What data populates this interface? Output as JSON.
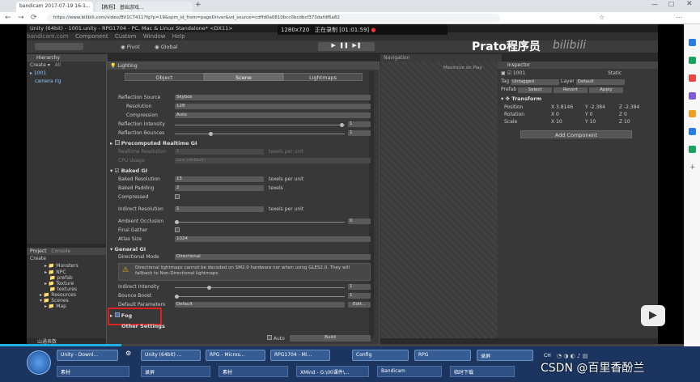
{
  "browser": {
    "tabs": [
      "bandicam 2017-07-19 16-1...",
      "【教程】 基础游戏..."
    ],
    "url": "https://www.bilibili.com/video/BV1C7411?fg?p=19&spm_id_from=pageDriver&vd_source=cdffd0a0810bcc0bcdbcf373dafdf6a82"
  },
  "recorder": {
    "watermark": "bandicam.com",
    "resolution": "1280x720",
    "time": "[01:01:59]",
    "rec_label": "正在录制"
  },
  "unity": {
    "title": "Unity (64bit) - 1001.unity - RPG1704 - PC, Mac & Linux Standalone* <DX11>",
    "menus": [
      "File",
      "Edit",
      "Assets",
      "GameObject",
      "Component",
      "Custom",
      "Window",
      "Help"
    ],
    "toolbar": {
      "pivot": "Pivot",
      "global": "Global"
    },
    "overlay_brand": "Prato程序员",
    "overlay_brand2": "bilibili"
  },
  "hierarchy": {
    "title": "Hierarchy",
    "create": "Create",
    "search": "All",
    "items": [
      "1001",
      "camera rig"
    ]
  },
  "project": {
    "tabs": [
      "Project",
      "Console"
    ],
    "create": "Create",
    "folders": [
      "Monsters",
      "NPC",
      "prefab",
      "Texture",
      "textures",
      "Resources",
      "Scenes",
      "Map"
    ]
  },
  "scene_view": {
    "tab": "Navigation",
    "maximize": "Maximize on Play",
    "mute": "Mu"
  },
  "inspector": {
    "title": "Inspector",
    "object_name": "1001",
    "static": "Static",
    "tag_label": "Tag",
    "tag_value": "Untagged",
    "layer_label": "Layer",
    "layer_value": "Default",
    "prefab_label": "Prefab",
    "prefab_btns": [
      "Select",
      "Revert",
      "Apply"
    ],
    "component": "Transform",
    "rows": [
      {
        "label": "Position",
        "x": "X 3.8146",
        "y": "Y -2.384",
        "z": "Z -2.384"
      },
      {
        "label": "Rotation",
        "x": "X 0",
        "y": "Y 0",
        "z": "Z 0"
      },
      {
        "label": "Scale",
        "x": "X 10",
        "y": "Y 10",
        "z": "Z 10"
      }
    ],
    "add_component": "Add Component"
  },
  "lighting": {
    "title": "Lighting",
    "tabs": [
      "Object",
      "Scene",
      "Lightmaps"
    ],
    "env": [
      {
        "label": "Reflection Source",
        "value": "Skybox"
      },
      {
        "label": "Resolution",
        "value": "128"
      },
      {
        "label": "Compression",
        "value": "Auto"
      },
      {
        "label": "Reflection Intensity",
        "value": "1"
      },
      {
        "label": "Reflection Bounces",
        "value": "1"
      }
    ],
    "precomputed": {
      "header": "Precomputed Realtime GI",
      "rows": [
        {
          "label": "Realtime Resolution",
          "value": "1",
          "unit": "texels per unit"
        },
        {
          "label": "CPU Usage",
          "value": "Low (default)",
          "unit": ""
        }
      ]
    },
    "baked": {
      "header": "Baked GI",
      "rows": [
        {
          "label": "Baked Resolution",
          "value": "15",
          "unit": "texels per unit"
        },
        {
          "label": "Baked Padding",
          "value": "2",
          "unit": "texels"
        },
        {
          "label": "Compressed",
          "value": "",
          "unit": ""
        },
        {
          "label": "Indirect Resolution",
          "value": "1",
          "unit": "texels per unit"
        },
        {
          "label": "Ambient Occlusion",
          "value": "0",
          "unit": ""
        },
        {
          "label": "Final Gather",
          "value": "",
          "unit": ""
        },
        {
          "label": "Atlas Size",
          "value": "1024",
          "unit": ""
        }
      ]
    },
    "general": {
      "header": "General GI",
      "directional_label": "Directional Mode",
      "directional_value": "Directional",
      "warning": "Directional lightmaps cannot be decoded on SM2.0 hardware nor when using GLES2.0. They will fallback to Non-Directional lightmaps.",
      "rows": [
        {
          "label": "Indirect Intensity",
          "value": "1"
        },
        {
          "label": "Bounce Boost",
          "value": "1"
        },
        {
          "label": "Default Parameters",
          "value": "Default"
        }
      ],
      "edit": "Edit..."
    },
    "fog": "Fog",
    "other": "Other Settings",
    "auto": "Auto",
    "build": "Build"
  },
  "status": {
    "bottom_left": "山通表数"
  },
  "taskbar": {
    "row1": [
      "Unity - Downl...",
      "Unity (64bit) ...",
      "RPG - Micros...",
      "RPG1704 - Mi...",
      "Config",
      "RPG",
      "录屏"
    ],
    "row2": [
      "素材",
      "录屏",
      "素材",
      "XMind - G:\\00课件\\...",
      "Bandicam",
      "临时下载"
    ],
    "tray": "CH",
    "watermark": "CSDN @百里香酚兰"
  }
}
